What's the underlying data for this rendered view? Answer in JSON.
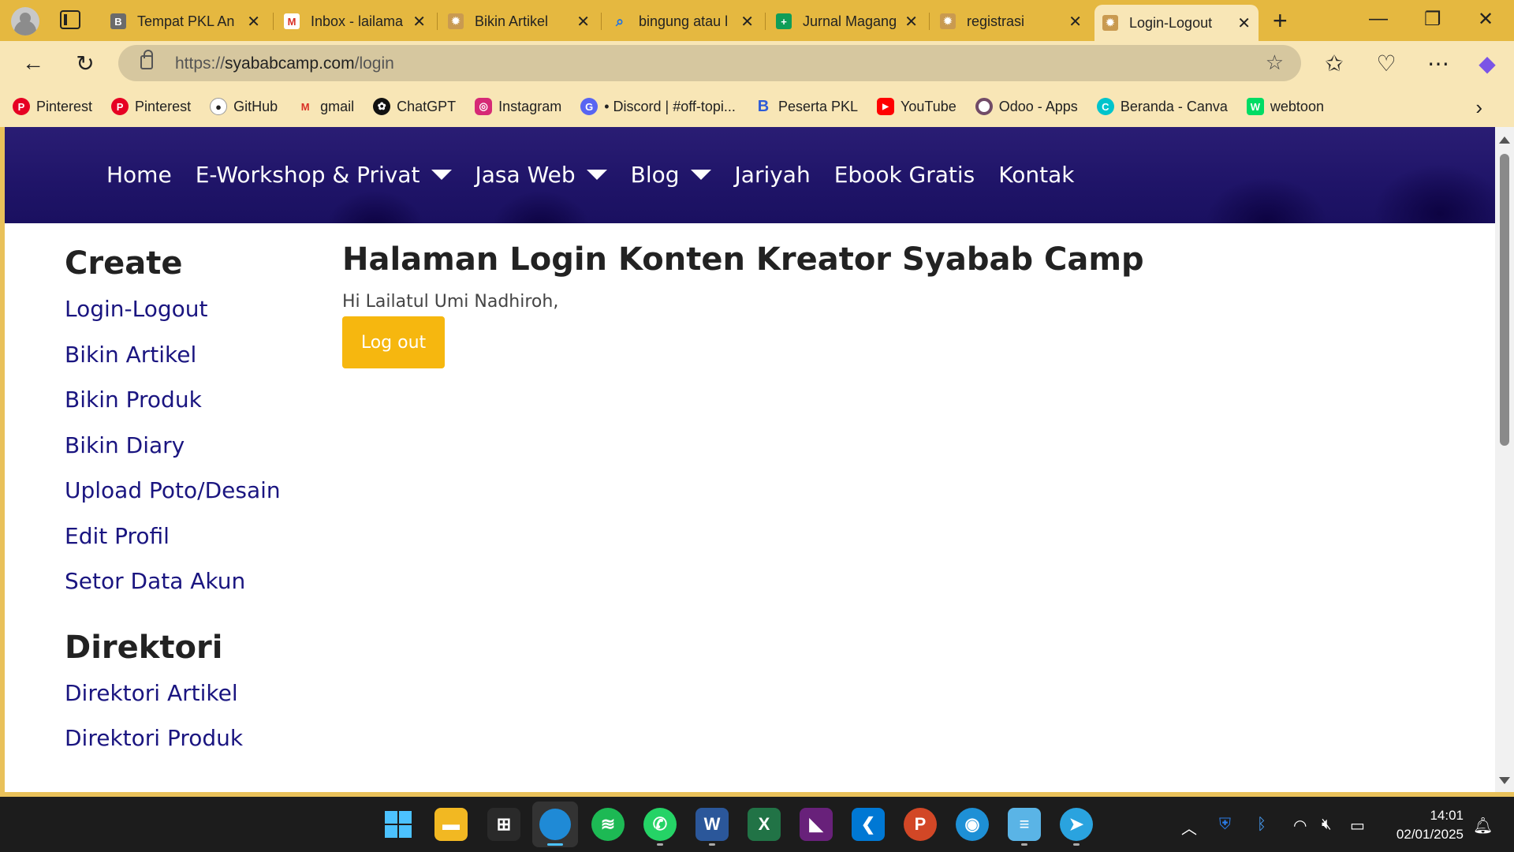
{
  "browser": {
    "tabs": [
      {
        "title": "Tempat PKL An",
        "icon": "b-icon",
        "color": "#555555"
      },
      {
        "title": "Inbox - lailama",
        "icon": "gmail-icon",
        "color": "#d93025"
      },
      {
        "title": "Bikin Artikel",
        "icon": "syabab-icon",
        "color": "#8a6d3b"
      },
      {
        "title": "bingung atau l",
        "icon": "search-icon",
        "color": "#1a73e8"
      },
      {
        "title": "Jurnal Magang",
        "icon": "sheets-icon",
        "color": "#0f9d58"
      },
      {
        "title": "registrasi",
        "icon": "syabab-icon",
        "color": "#8a6d3b"
      },
      {
        "title": "Login-Logout",
        "icon": "syabab-icon",
        "color": "#8a6d3b"
      }
    ],
    "url_prefix": "https://",
    "url_host": "syababcamp.com",
    "url_path": "/login",
    "bookmarks": [
      {
        "label": "Pinterest",
        "icon": "pinterest-icon",
        "color": "#e60023"
      },
      {
        "label": "Pinterest",
        "icon": "pinterest-icon",
        "color": "#e60023"
      },
      {
        "label": "GitHub",
        "icon": "github-icon",
        "color": "#222222"
      },
      {
        "label": "gmail",
        "icon": "gmail-icon",
        "color": "#d93025"
      },
      {
        "label": "ChatGPT",
        "icon": "chatgpt-icon",
        "color": "#111111"
      },
      {
        "label": "Instagram",
        "icon": "instagram-icon",
        "color": "#d62976"
      },
      {
        "label": "• Discord | #off-topi...",
        "icon": "discord-icon",
        "color": "#5865f2"
      },
      {
        "label": "Peserta PKL",
        "icon": "b-icon",
        "color": "#2d5bd8"
      },
      {
        "label": "YouTube",
        "icon": "youtube-icon",
        "color": "#ff0000"
      },
      {
        "label": "Odoo - Apps",
        "icon": "odoo-icon",
        "color": "#714b67"
      },
      {
        "label": "Beranda - Canva",
        "icon": "canva-icon",
        "color": "#00c4cc"
      },
      {
        "label": "webtoon",
        "icon": "webtoon-icon",
        "color": "#00dc64"
      }
    ]
  },
  "site": {
    "nav": [
      {
        "label": "Home",
        "dropdown": false
      },
      {
        "label": "E-Workshop & Privat",
        "dropdown": true
      },
      {
        "label": "Jasa Web",
        "dropdown": true
      },
      {
        "label": "Blog",
        "dropdown": true
      },
      {
        "label": "Jariyah",
        "dropdown": false
      },
      {
        "label": "Ebook Gratis",
        "dropdown": false
      },
      {
        "label": "Kontak",
        "dropdown": false
      }
    ],
    "sidebar": {
      "create_heading": "Create",
      "create_links": [
        "Login-Logout",
        "Bikin Artikel",
        "Bikin Produk",
        "Bikin Diary",
        "Upload Poto/Desain",
        "Edit Profil",
        "Setor Data Akun"
      ],
      "direktori_heading": "Direktori",
      "direktori_links": [
        "Direktori Artikel",
        "Direktori Produk"
      ]
    },
    "main": {
      "title": "Halaman Login Konten Kreator Syabab Camp",
      "greeting": "Hi Lailatul Umi Nadhiroh,",
      "logout_label": "Log out"
    },
    "colors": {
      "accent_button": "#f6b70f",
      "link": "#1a1580",
      "hero": "#1f1468"
    }
  },
  "taskbar": {
    "time": "14:01",
    "date": "02/01/2025"
  }
}
